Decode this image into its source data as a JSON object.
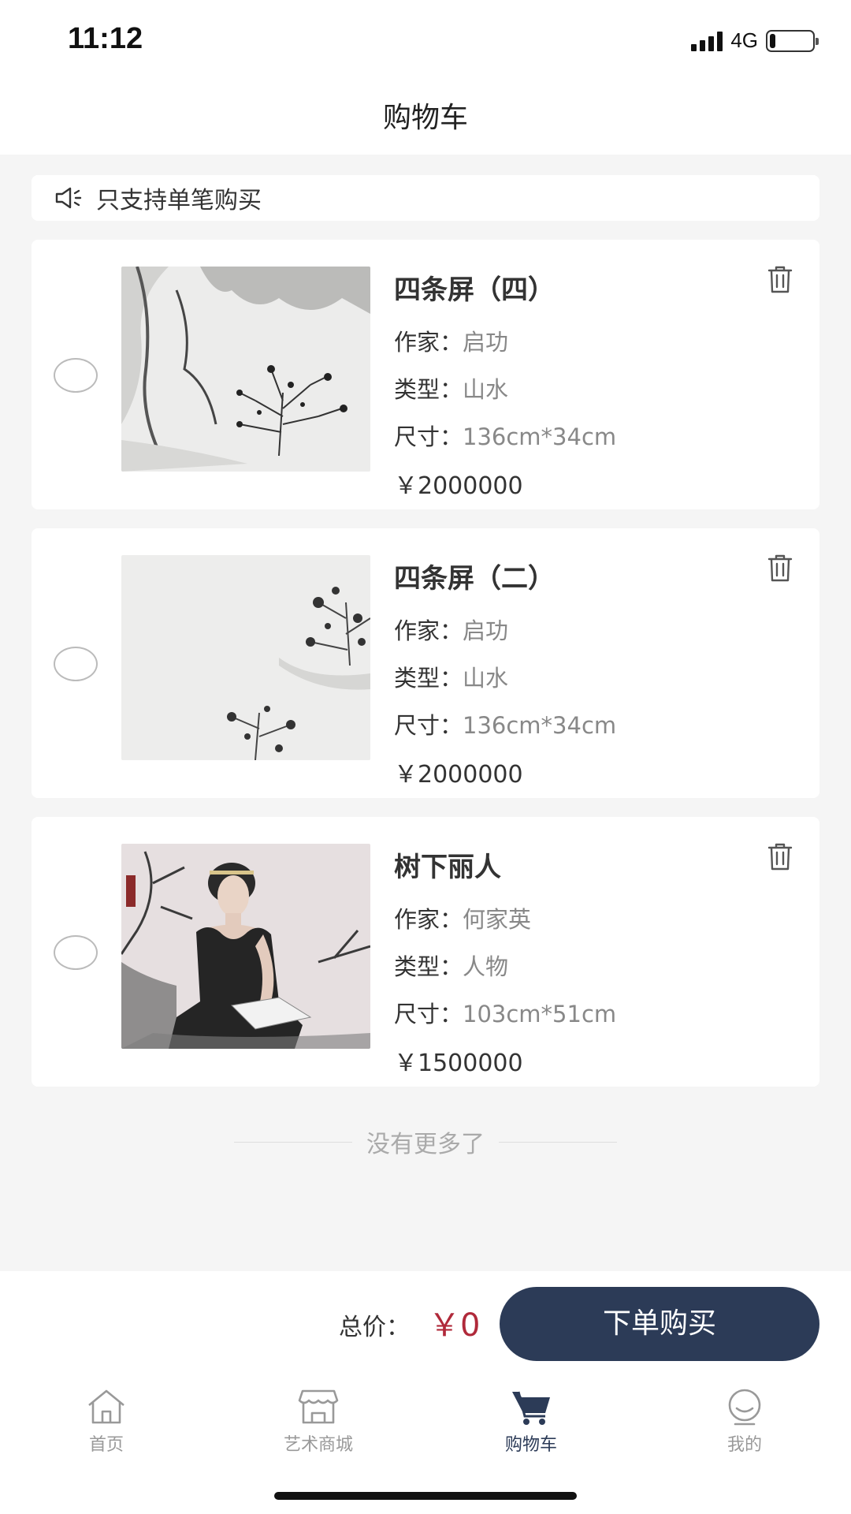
{
  "status_bar": {
    "time": "11:12",
    "network": "4G",
    "battery_level": 0.14
  },
  "header": {
    "title": "购物车"
  },
  "notice": {
    "icon": "speaker-icon",
    "text": "只支持单笔购买"
  },
  "labels": {
    "artist": "作家：",
    "type": "类型：",
    "size": "尺寸："
  },
  "cart_items": [
    {
      "title": "四条屏（四）",
      "artist": "启功",
      "type": "山水",
      "size": "136cm*34cm",
      "price": "￥2000000",
      "checked": false
    },
    {
      "title": "四条屏（二）",
      "artist": "启功",
      "type": "山水",
      "size": "136cm*34cm",
      "price": "￥2000000",
      "checked": false
    },
    {
      "title": "树下丽人",
      "artist": "何家英",
      "type": "人物",
      "size": "103cm*51cm",
      "price": "￥1500000",
      "checked": false
    }
  ],
  "list_footer": "没有更多了",
  "checkout": {
    "total_label": "总价：",
    "total_value": "￥0",
    "order_button": "下单购买"
  },
  "tabbar": {
    "items": [
      {
        "label": "首页",
        "icon": "home-icon",
        "active": false
      },
      {
        "label": "艺术商城",
        "icon": "store-icon",
        "active": false
      },
      {
        "label": "购物车",
        "icon": "cart-icon",
        "active": true
      },
      {
        "label": "我的",
        "icon": "profile-icon",
        "active": false
      }
    ]
  },
  "colors": {
    "accent": "#2c3b57",
    "price_red": "#b0293a",
    "background": "#f5f5f5"
  }
}
